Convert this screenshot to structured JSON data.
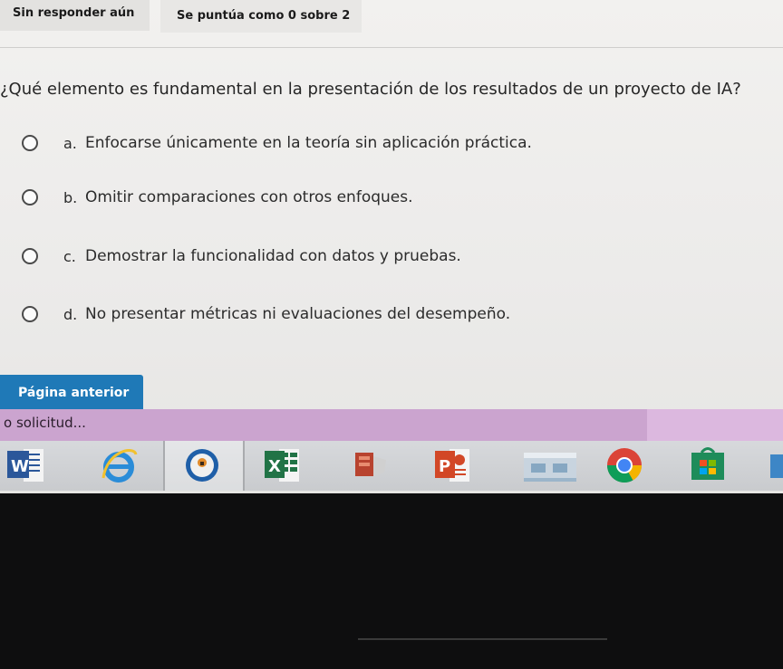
{
  "status": {
    "unanswered": "Sin responder aún",
    "score": "Se puntúa como 0 sobre 2"
  },
  "question": {
    "text": "¿Qué elemento es fundamental en la presentación de los resultados de un proyecto de IA?",
    "options": [
      {
        "letter": "a.",
        "text": "Enfocarse únicamente en la teoría sin aplicación práctica."
      },
      {
        "letter": "b.",
        "text": "Omitir comparaciones con otros enfoques."
      },
      {
        "letter": "c.",
        "text": "Demostrar la funcionalidad con datos y pruebas."
      },
      {
        "letter": "d.",
        "text": "No presentar métricas ni evaluaciones del desempeño."
      }
    ]
  },
  "navigation": {
    "previous_label": "Página anterior"
  },
  "browser": {
    "tab_text": "o solicitud..."
  },
  "taskbar": {
    "icons": [
      "word-icon",
      "internet-explorer-icon",
      "photos-icon",
      "excel-icon",
      "sway-icon",
      "powerpoint-icon",
      "network-folder-icon",
      "chrome-icon",
      "store-icon"
    ],
    "word_glyph": "W",
    "excel_glyph": "X",
    "powerpoint_glyph": "P"
  },
  "colors": {
    "primary_button": "#1f79b7",
    "browser_bar": "#dcb8df",
    "taskbar": "#cfd1d4"
  }
}
